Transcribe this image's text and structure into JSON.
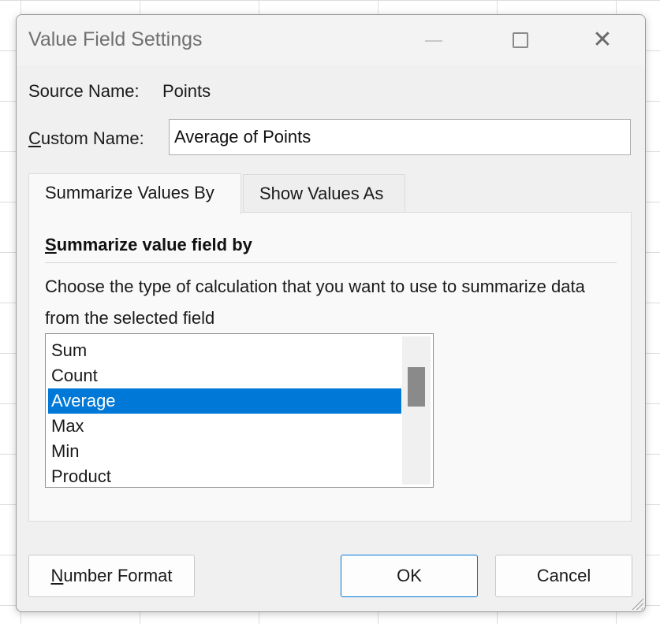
{
  "dialog": {
    "title": "Value Field Settings",
    "source_name_label": "Source Name:",
    "source_name_value": "Points",
    "custom_name_label_first": "C",
    "custom_name_label_rest": "ustom Name:",
    "custom_name_value": "Average of Points"
  },
  "tabs": [
    {
      "label": "Summarize Values By",
      "active": true
    },
    {
      "label": "Show Values As",
      "active": false
    }
  ],
  "panel": {
    "section_title_first": "S",
    "section_title_rest": "ummarize value field by",
    "description": "Choose the type of calculation that you want to use to summarize data from the selected field",
    "items": [
      "Sum",
      "Count",
      "Average",
      "Max",
      "Min",
      "Product"
    ],
    "selected_item": "Average"
  },
  "buttons": {
    "number_format_first": "N",
    "number_format_rest": "umber Format",
    "ok": "OK",
    "cancel": "Cancel"
  },
  "colors": {
    "selection": "#0078d7",
    "dialog_bg": "#f0f0f0"
  },
  "icons": [
    "minimize-icon",
    "maximize-icon",
    "close-icon",
    "resize-grip-icon"
  ]
}
